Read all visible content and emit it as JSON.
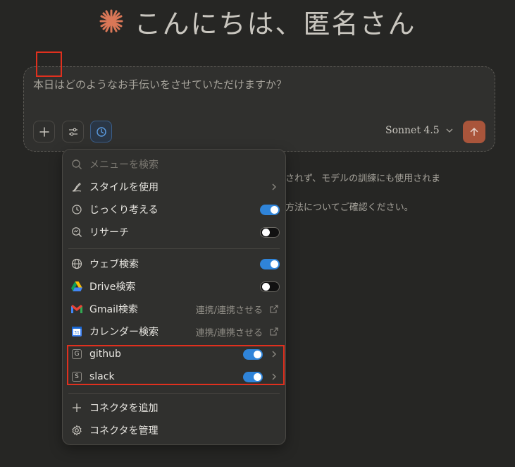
{
  "greeting": "こんにちは、匿名さん",
  "composer": {
    "prompt": "本日はどのようなお手伝いをさせていただけますか？",
    "model": "Sonnet 4.5"
  },
  "background_text": {
    "line1": "されず、モデルの訓練にも使用されま",
    "line2": "方法についてご確認ください。"
  },
  "menu": {
    "search_placeholder": "メニューを検索",
    "items": [
      {
        "label": "スタイルを使用",
        "icon": "pen-icon"
      },
      {
        "label": "じっくり考える",
        "icon": "clock-icon",
        "toggle": "on"
      },
      {
        "label": "リサーチ",
        "icon": "research-icon",
        "toggle": "off"
      },
      {
        "label": "ウェブ検索",
        "icon": "globe-icon",
        "toggle": "on"
      },
      {
        "label": "Drive検索",
        "icon": "google-drive-icon",
        "toggle": "off"
      },
      {
        "label": "Gmail検索",
        "icon": "gmail-icon",
        "sub": "連携/連携させる"
      },
      {
        "label": "カレンダー検索",
        "icon": "google-calendar-icon",
        "sub": "連携/連携させる"
      },
      {
        "label": "github",
        "icon": "github-badge-icon",
        "badge": "G",
        "toggle": "on"
      },
      {
        "label": "slack",
        "icon": "slack-badge-icon",
        "badge": "S",
        "toggle": "on"
      },
      {
        "label": "コネクタを追加",
        "icon": "plus-icon"
      },
      {
        "label": "コネクタを管理",
        "icon": "gear-icon"
      }
    ]
  },
  "colors": {
    "background": "#262624",
    "accent_orange": "#d97757",
    "toggle_on": "#2f84d9",
    "send_button": "#a9553b",
    "highlight_red": "#e0301e"
  }
}
